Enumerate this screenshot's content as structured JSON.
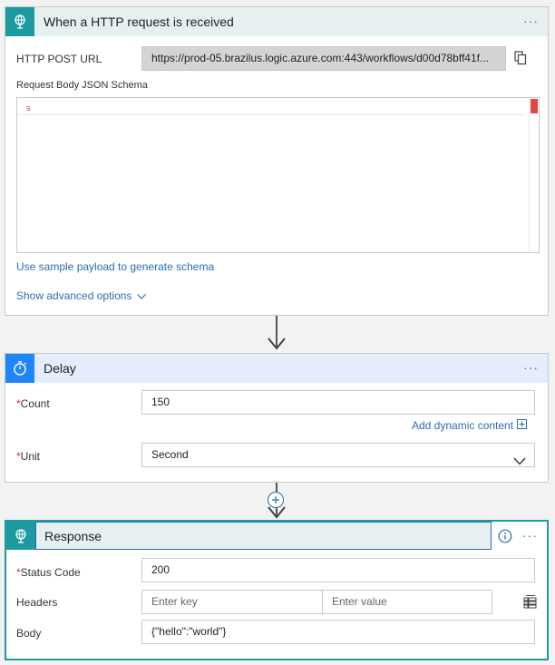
{
  "trigger": {
    "title": "When a HTTP request is received",
    "url_label": "HTTP POST URL",
    "url_value": "https://prod-05.brazilus.logic.azure.com:443/workflows/d00d78bff41f...",
    "schema_label": "Request Body JSON Schema",
    "schema_gutter_mark": "s",
    "sample_link": "Use sample payload to generate schema",
    "advanced_link": "Show advanced options",
    "ellipsis": "···"
  },
  "delay": {
    "title": "Delay",
    "count_label": "Count",
    "count_value": "150",
    "dynamic_link": "Add dynamic content",
    "unit_label": "Unit",
    "unit_value": "Second",
    "ellipsis": "···"
  },
  "response": {
    "title": "Response",
    "status_label": "Status Code",
    "status_value": "200",
    "headers_label": "Headers",
    "key_placeholder": "Enter key",
    "value_placeholder": "Enter value",
    "body_label": "Body",
    "body_value": "{\"hello\":\"world\"}",
    "ellipsis": "···"
  },
  "required_marker": "*",
  "colors": {
    "trigger_header": "#e6f0f0",
    "trigger_icon_bg": "#1c9aa0",
    "delay_header": "#e3edfb",
    "delay_icon_bg": "#1f85ff",
    "response_border": "#1c9aa0",
    "link": "#2b6cb0",
    "required": "#d13438"
  }
}
